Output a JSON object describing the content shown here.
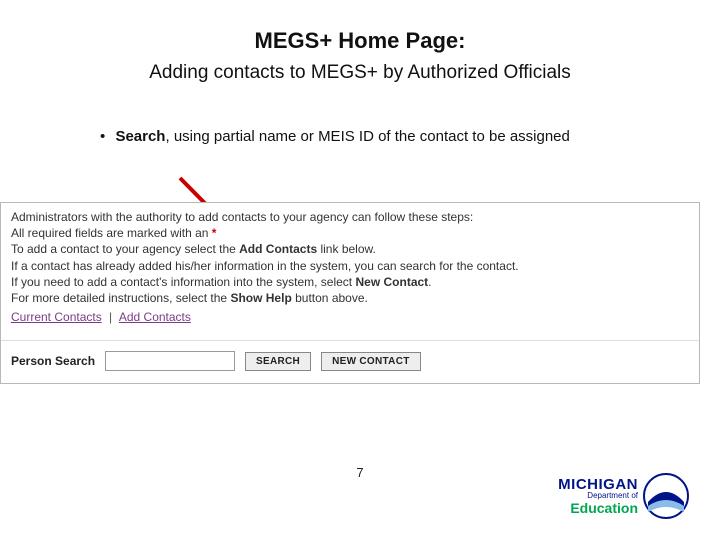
{
  "title": "MEGS+ Home Page:",
  "subtitle": "Adding contacts to MEGS+ by Authorized Officials",
  "bullet": {
    "strong": "Search",
    "rest": ", using partial name or MEIS ID of the contact to be assigned"
  },
  "panel": {
    "line1": "Administrators with the authority to add contacts to your agency can follow these steps:",
    "line2_pre": "All required fields are marked with an ",
    "asterisk": "*",
    "line3_pre": "To add a contact to your agency select the ",
    "line3_bold": "Add Contacts",
    "line3_post": " link below.",
    "line4": "If a contact has already added his/her information in the system, you can search for the contact.",
    "line5_pre": "If you need to add a contact's information into the system, select ",
    "line5_bold": "New Contact",
    "line5_post": ".",
    "line6_pre": "For more detailed instructions, select the ",
    "line6_bold": "Show Help",
    "line6_post": " button above.",
    "link_current": "Current Contacts",
    "link_add": "Add Contacts",
    "search_label": "Person Search",
    "search_value": "",
    "btn_search": "SEARCH",
    "btn_new": "NEW CONTACT"
  },
  "page_number": "7",
  "logo": {
    "line1": "MICHIGAN",
    "line2": "Department of",
    "line3": "Education"
  }
}
